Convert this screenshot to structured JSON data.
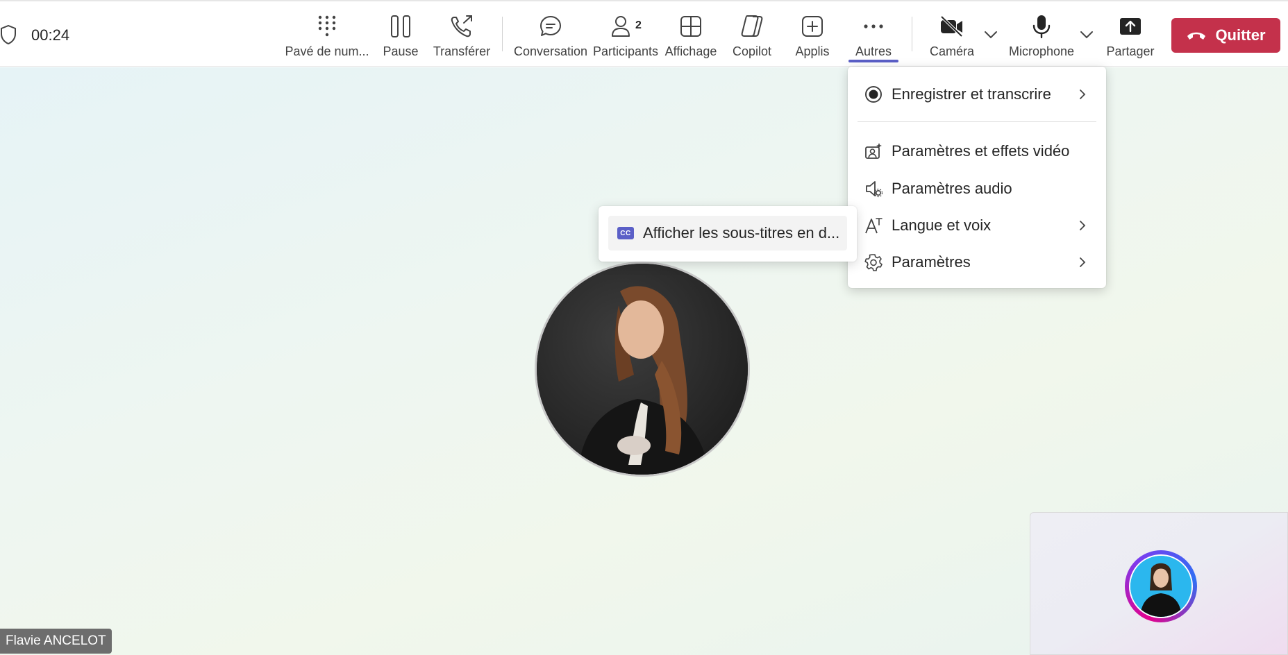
{
  "call": {
    "timer": "00:24"
  },
  "toolbar": {
    "items": [
      {
        "id": "dialpad",
        "label": "Pavé de num...",
        "icon": "dialpad-icon"
      },
      {
        "id": "pause",
        "label": "Pause",
        "icon": "pause-icon"
      },
      {
        "id": "transfer",
        "label": "Transférer",
        "icon": "transfer-call-icon"
      },
      {
        "id": "chat",
        "label": "Conversation",
        "icon": "chat-icon"
      },
      {
        "id": "participants",
        "label": "Participants",
        "icon": "people-icon",
        "badge": "2"
      },
      {
        "id": "view",
        "label": "Affichage",
        "icon": "grid-view-icon"
      },
      {
        "id": "copilot",
        "label": "Copilot",
        "icon": "copilot-icon"
      },
      {
        "id": "apps",
        "label": "Applis",
        "icon": "add-app-icon"
      },
      {
        "id": "more",
        "label": "Autres",
        "icon": "more-icon",
        "active": true
      },
      {
        "id": "camera",
        "label": "Caméra",
        "icon": "camera-off-icon"
      },
      {
        "id": "mic",
        "label": "Microphone",
        "icon": "microphone-icon"
      },
      {
        "id": "share",
        "label": "Partager",
        "icon": "share-icon"
      }
    ],
    "leave_label": "Quitter"
  },
  "more_menu": {
    "items": [
      {
        "label": "Enregistrer et transcrire",
        "icon": "record-icon",
        "has_submenu": true
      },
      {
        "label": "Paramètres et effets vidéo",
        "icon": "video-effects-icon",
        "has_submenu": false
      },
      {
        "label": "Paramètres audio",
        "icon": "audio-settings-icon",
        "has_submenu": false
      },
      {
        "label": "Langue et voix",
        "icon": "language-icon",
        "has_submenu": true
      },
      {
        "label": "Paramètres",
        "icon": "settings-gear-icon",
        "has_submenu": true
      }
    ]
  },
  "submenu": {
    "item_label": "Afficher les sous-titres en d...",
    "badge": "CC"
  },
  "participant": {
    "name": "Flavie ANCELOT"
  },
  "colors": {
    "accent": "#5b5fc7",
    "leave": "#c4314b"
  }
}
